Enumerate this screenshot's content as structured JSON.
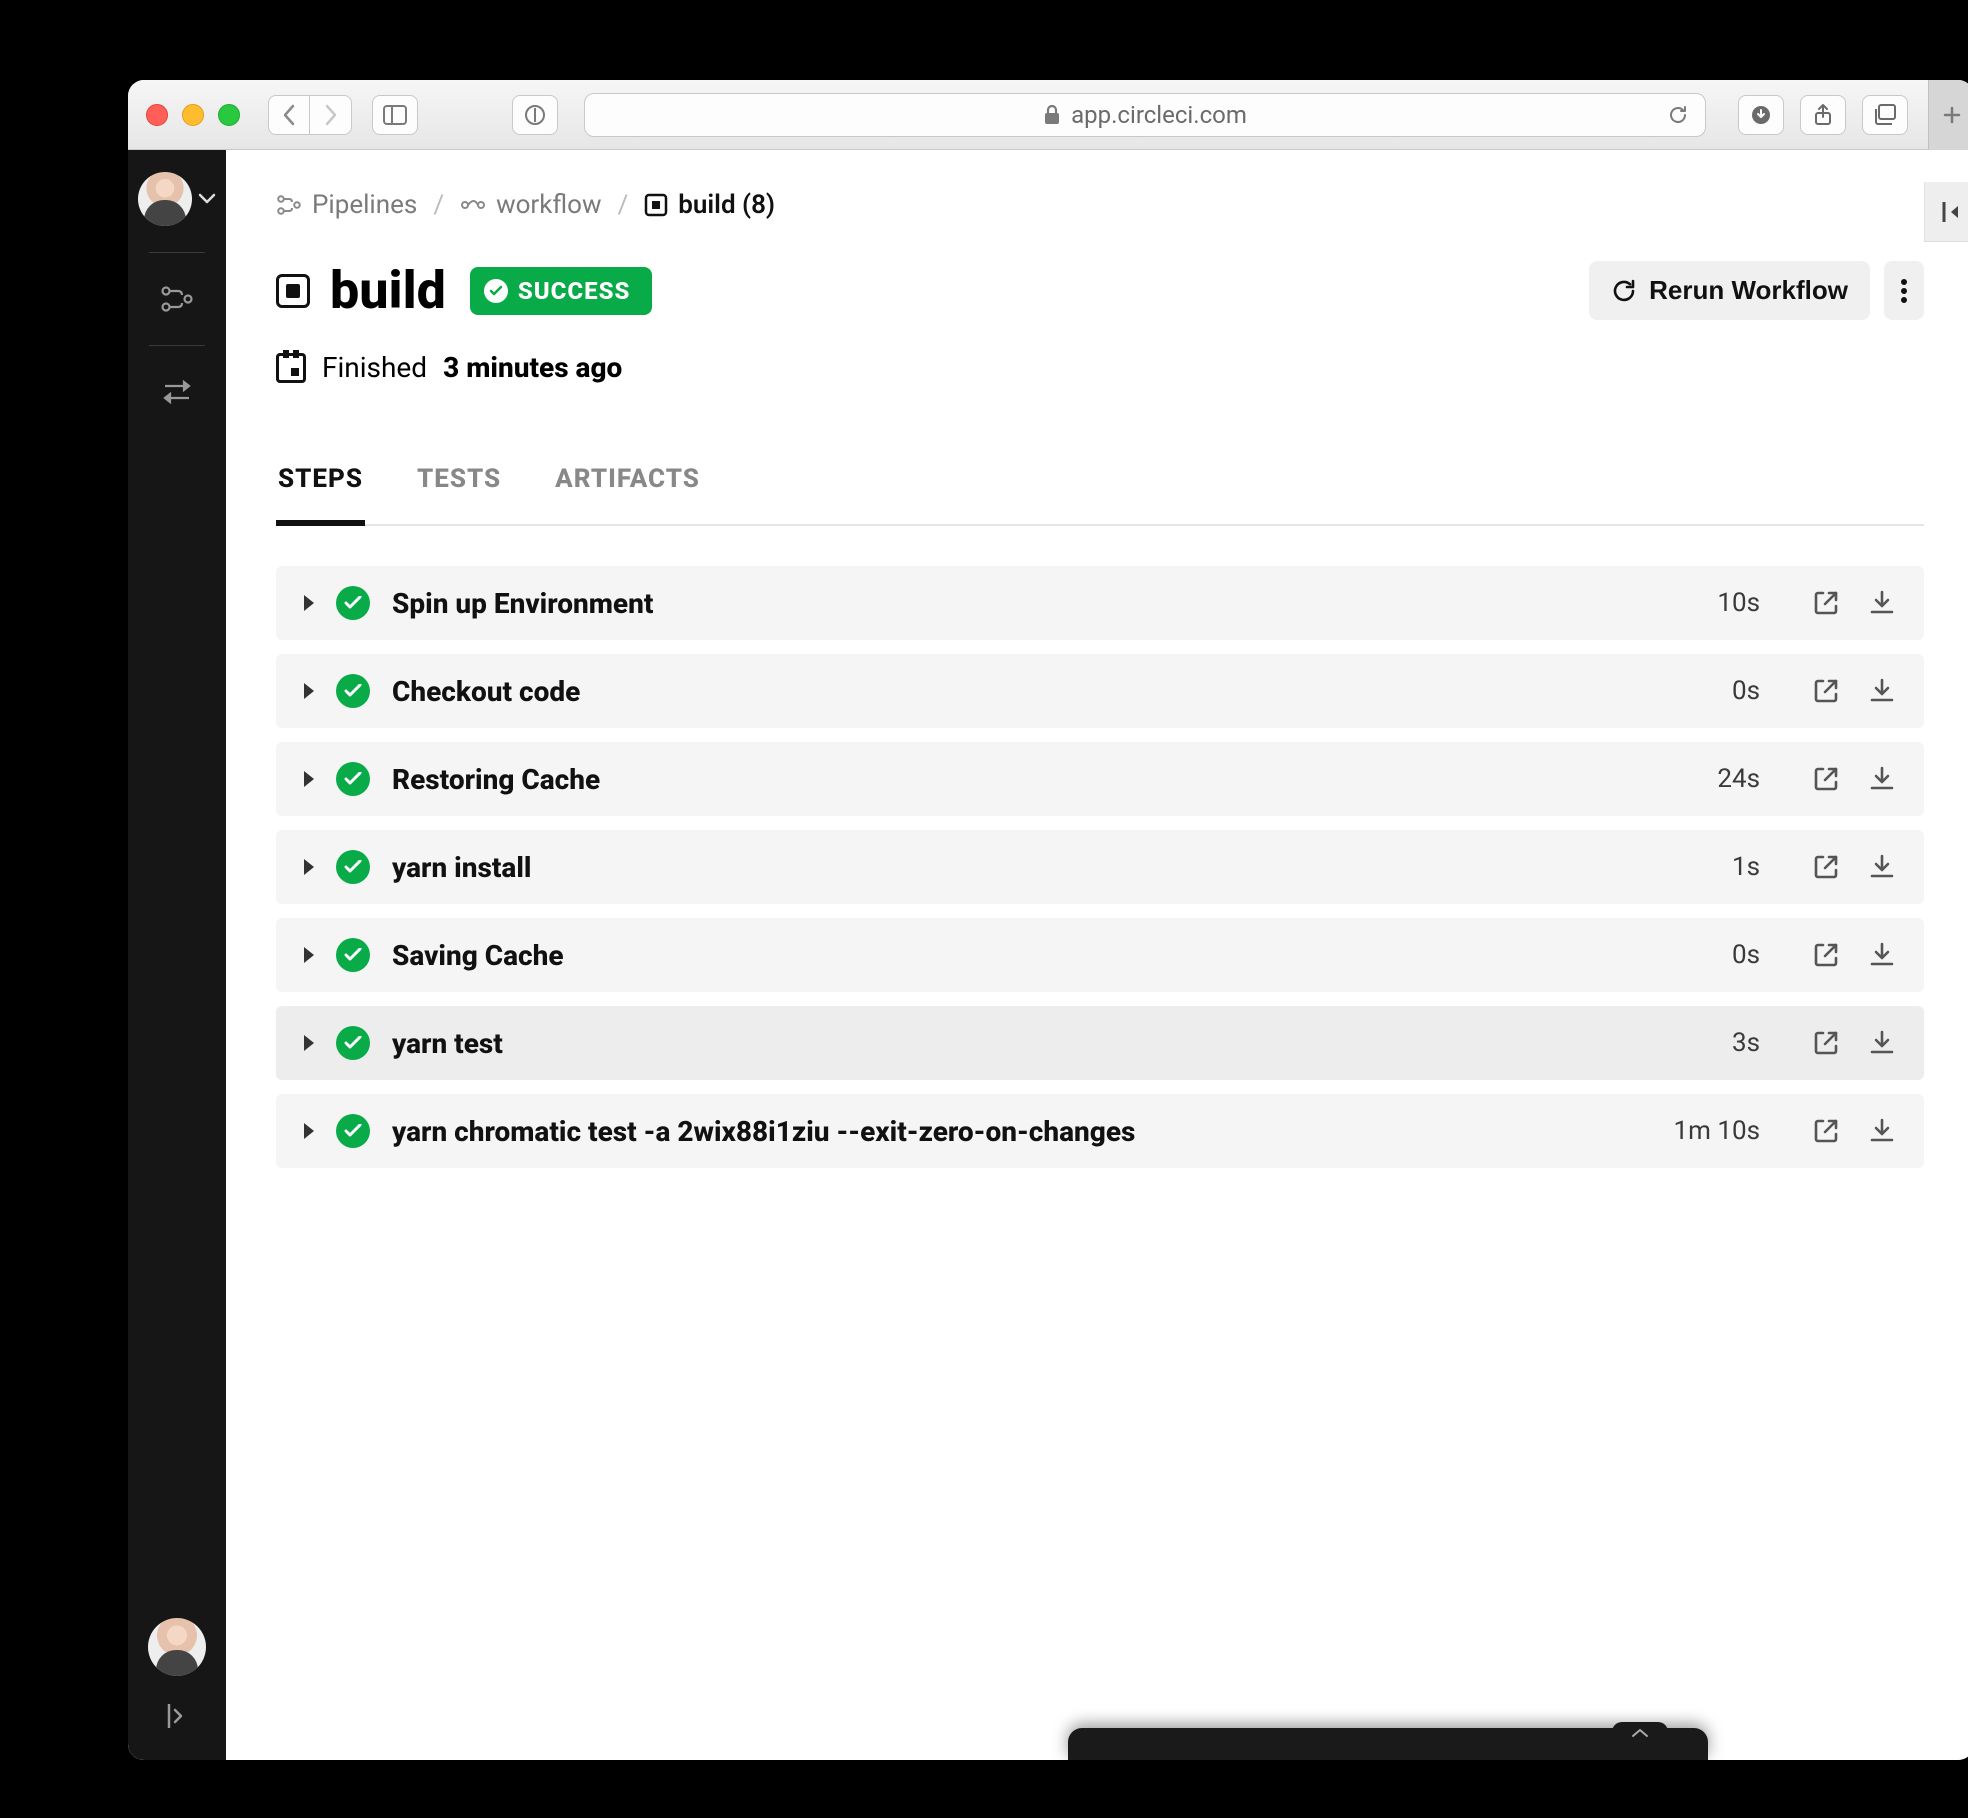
{
  "browser": {
    "url_host": "app.circleci.com"
  },
  "breadcrumb": {
    "root": "Pipelines",
    "workflow": "workflow",
    "current": "build (8)"
  },
  "job": {
    "title": "build",
    "status": "SUCCESS",
    "finished_prefix": "Finished",
    "finished_bold": "3 minutes ago"
  },
  "actions": {
    "rerun": "Rerun Workflow"
  },
  "tabs": {
    "steps": "STEPS",
    "tests": "TESTS",
    "artifacts": "ARTIFACTS"
  },
  "steps": [
    {
      "name": "Spin up Environment",
      "time": "10s"
    },
    {
      "name": "Checkout code",
      "time": "0s"
    },
    {
      "name": "Restoring Cache",
      "time": "24s"
    },
    {
      "name": "yarn install",
      "time": "1s"
    },
    {
      "name": "Saving Cache",
      "time": "0s"
    },
    {
      "name": "yarn test",
      "time": "3s"
    },
    {
      "name": "yarn chromatic test -a 2wix88i1ziu --exit-zero-on-changes",
      "time": "1m 10s"
    }
  ]
}
